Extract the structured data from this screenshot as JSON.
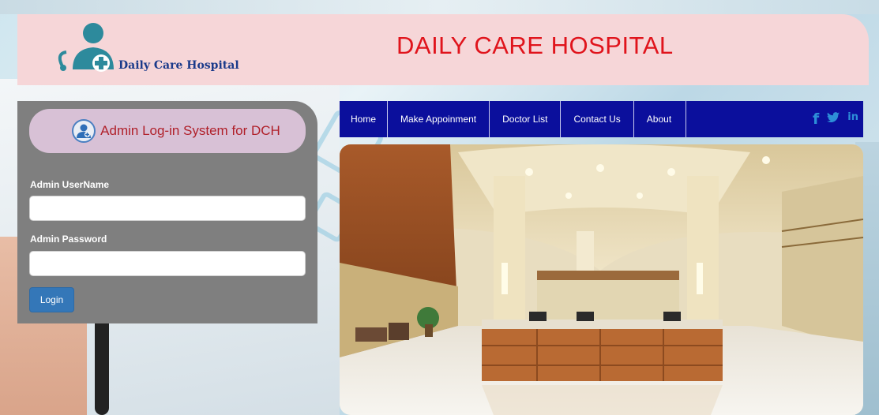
{
  "header": {
    "logo_text": "Daily Care Hospital",
    "site_title": "DAILY CARE HOSPITAL"
  },
  "login": {
    "banner_title": "Admin Log-in System for DCH",
    "username_label": "Admin UserName",
    "username_value": "",
    "password_label": "Admin Password",
    "password_value": "",
    "login_button": "Login"
  },
  "nav": {
    "items": [
      {
        "label": "Home"
      },
      {
        "label": "Make Appoinment"
      },
      {
        "label": "Doctor List"
      },
      {
        "label": "Contact Us"
      },
      {
        "label": "About"
      }
    ],
    "social": {
      "facebook": "f",
      "twitter": "🐦",
      "linkedin": "in"
    }
  },
  "colors": {
    "header_bg": "#f6d6d8",
    "title_red": "#e0141c",
    "panel_gray": "#7f7f7f",
    "banner_pink": "#d8c1d6",
    "nav_blue": "#0b0f9c",
    "button_blue": "#3477b8"
  },
  "icons": {
    "logo": "doctor-logo-icon",
    "banner": "admin-user-icon",
    "facebook": "facebook-icon",
    "twitter": "twitter-icon",
    "linkedin": "linkedin-icon"
  }
}
